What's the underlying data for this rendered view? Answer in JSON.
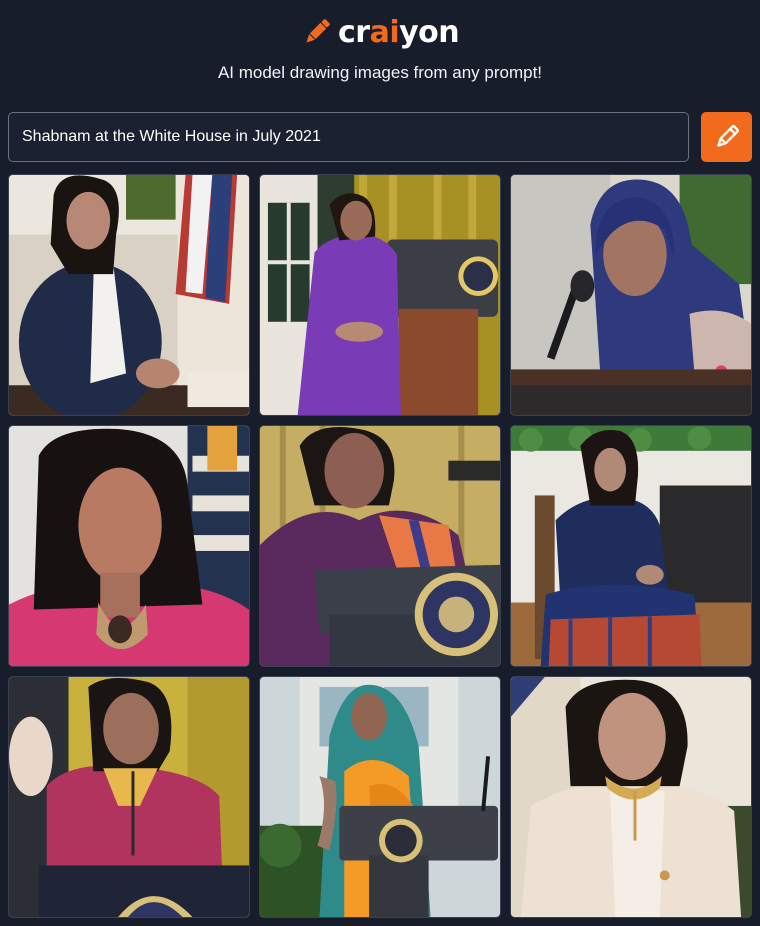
{
  "brand": {
    "name_prefix": "cr",
    "name_accent": "ai",
    "name_suffix": "yon",
    "accent_color": "#f26b1d",
    "logo_icon": "pencil-icon"
  },
  "tagline": "AI model drawing images from any prompt!",
  "prompt": {
    "value": "Shabnam at the White House in July 2021",
    "draw_button_icon": "pencil-icon"
  },
  "results": {
    "count": 9,
    "images": [
      {
        "scene": "woman in navy blazer seated at desk, American flag behind"
      },
      {
        "scene": "woman in purple dress standing beside podium with seal"
      },
      {
        "scene": "woman in blue headscarf speaking into microphone"
      },
      {
        "scene": "woman with dark hair and pink shawl, portrait"
      },
      {
        "scene": "woman in purple sari at podium with presidential seal"
      },
      {
        "scene": "woman in navy outfit seated outdoors by hedge"
      },
      {
        "scene": "woman in magenta jacket at podium, gold curtains"
      },
      {
        "scene": "woman in orange sari and teal scarf at podium"
      },
      {
        "scene": "woman in cream outfit with gold necklace, portrait"
      }
    ]
  }
}
